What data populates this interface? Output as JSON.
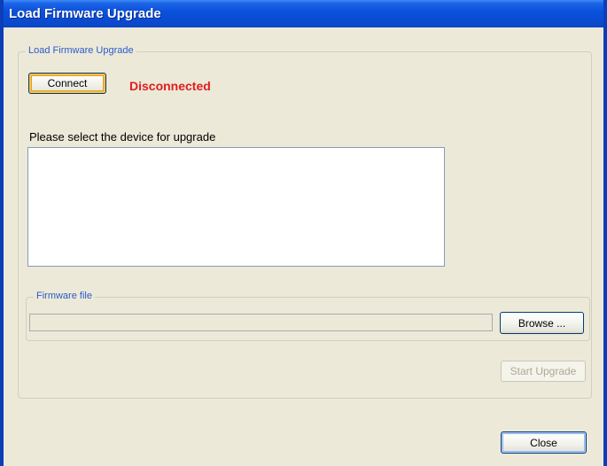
{
  "window": {
    "title": "Load Firmware Upgrade"
  },
  "main_group": {
    "legend": "Load Firmware Upgrade",
    "connect_button_label": "Connect",
    "connection_status": "Disconnected",
    "device_prompt": "Please select the device for upgrade",
    "device_list_items": []
  },
  "firmware_group": {
    "legend": "Firmware file",
    "file_path_value": "",
    "browse_button_label": "Browse ..."
  },
  "start_upgrade_button_label": "Start Upgrade",
  "close_button_label": "Close",
  "colors": {
    "status_disconnected": "#e21d1d",
    "group_legend": "#2b5acb",
    "titlebar": "#0a52dc"
  }
}
